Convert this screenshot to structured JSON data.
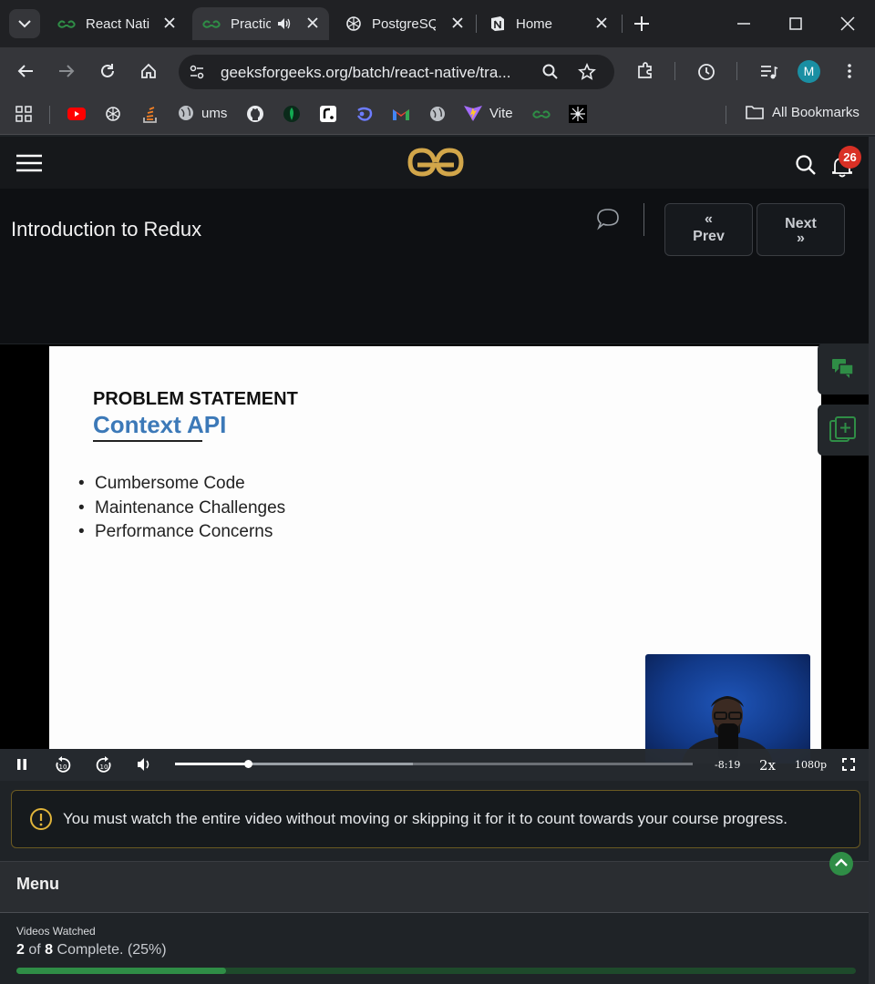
{
  "browser": {
    "tabs": [
      {
        "title": "React Nati",
        "icon": "gfg-logo-icon",
        "active": false
      },
      {
        "title": "Practic",
        "icon": "gfg-logo-icon",
        "active": true,
        "audio": true
      },
      {
        "title": "PostgreSQ",
        "icon": "chatgpt-icon",
        "active": false
      },
      {
        "title": "Home",
        "icon": "notion-icon",
        "active": false
      }
    ],
    "url": "geeksforgeeks.org/batch/react-native/tra...",
    "profile_initial": "M",
    "bookmarks": [
      {
        "label": "ums"
      },
      {
        "label": "Vite"
      },
      {
        "label": "All Bookmarks"
      }
    ]
  },
  "site": {
    "notifications_count": "26"
  },
  "lesson": {
    "title": "Introduction to Redux",
    "prev_label": "Prev",
    "next_label": "Next"
  },
  "slide": {
    "heading": "PROBLEM STATEMENT",
    "subheading": "Context API",
    "bullets": [
      "Cumbersome Code",
      "Maintenance Challenges",
      "Performance Concerns"
    ]
  },
  "player": {
    "time_remaining": "-8:19",
    "speed": "2x",
    "quality": "1080p",
    "progress": 0.14,
    "buffered": 0.46
  },
  "notice": {
    "text": "You must watch the entire video without moving or skipping it for it to count towards your course progress."
  },
  "menu": {
    "label": "Menu"
  },
  "progress": {
    "label": "Videos Watched",
    "watched": "2",
    "of_word": "of",
    "total": "8",
    "suffix": "Complete. (25%)",
    "fraction": 0.25
  },
  "colors": {
    "brand_green": "#2f8d46",
    "notification_red": "#d93025",
    "slide_accent": "#3c79b8",
    "notice_border": "#6b5a22"
  }
}
